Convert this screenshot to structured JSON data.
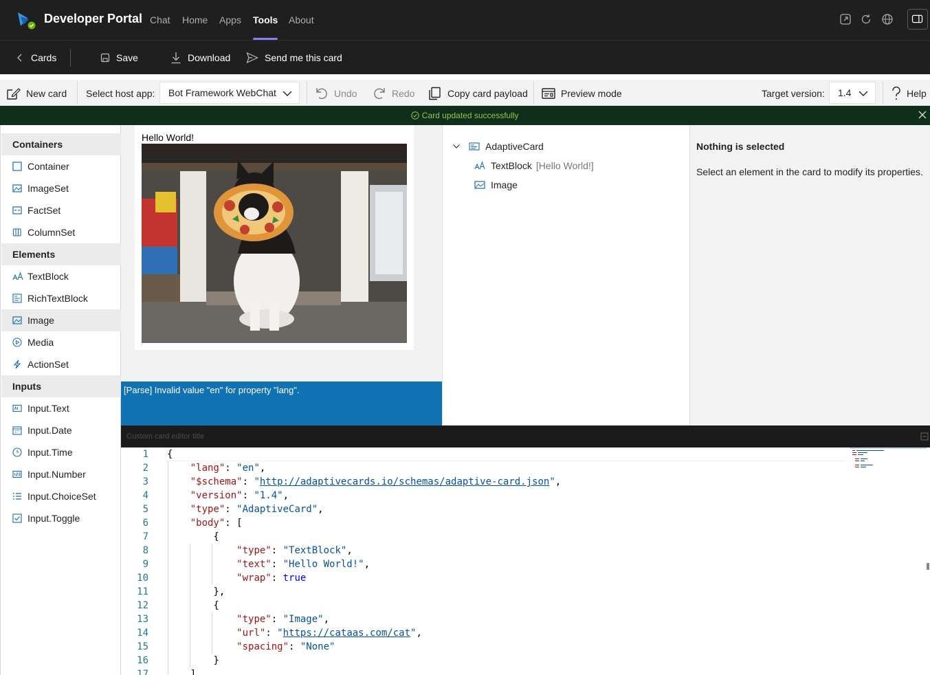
{
  "app": {
    "title": "Developer Portal",
    "nav_tabs": [
      "Chat",
      "Home",
      "Apps",
      "Tools",
      "About"
    ],
    "active_tab": "Tools",
    "accent_color": "#7f85f5"
  },
  "commands": {
    "back_label": "Cards",
    "save_label": "Save",
    "download_label": "Download",
    "send_label": "Send me this card"
  },
  "toolbar": {
    "new_card": "New card",
    "host_app_label": "Select host app:",
    "host_app_value": "Bot Framework WebChat",
    "undo": "Undo",
    "redo": "Redo",
    "copy_payload": "Copy card payload",
    "preview_mode": "Preview mode",
    "target_version_label": "Target version:",
    "target_version_value": "1.4",
    "help": "Help"
  },
  "toast": {
    "message": "Card updated successfully",
    "color": "#92c353"
  },
  "palette": {
    "groups": [
      {
        "header": "Containers",
        "items": [
          "Container",
          "ImageSet",
          "FactSet",
          "ColumnSet"
        ]
      },
      {
        "header": "Elements",
        "items": [
          "TextBlock",
          "RichTextBlock",
          "Image",
          "Media",
          "ActionSet"
        ]
      },
      {
        "header": "Inputs",
        "items": [
          "Input.Text",
          "Input.Date",
          "Input.Time",
          "Input.Number",
          "Input.ChoiceSet",
          "Input.Toggle"
        ]
      }
    ],
    "selected_item": "Image"
  },
  "card": {
    "text": "Hello World!",
    "image_alt": "cat-photo"
  },
  "error_message": "[Parse] Invalid value \"en\" for property \"lang\".",
  "tree": {
    "root": "AdaptiveCard",
    "children": [
      {
        "label": "TextBlock",
        "hint": "[Hello World!]"
      },
      {
        "label": "Image",
        "hint": ""
      }
    ]
  },
  "properties": {
    "title": "Nothing is selected",
    "body": "Select an element in the card to modify its properties."
  },
  "editor": {
    "title": "Custom card editor title",
    "line_numbers": [
      "1",
      "2",
      "3",
      "4",
      "5",
      "6",
      "7",
      "8",
      "9",
      "10",
      "11",
      "12",
      "13",
      "14",
      "15",
      "16",
      "17"
    ],
    "lines": [
      "{",
      "    \"lang\": \"en\",",
      "    \"$schema\": \"http://adaptivecards.io/schemas/adaptive-card.json\",",
      "    \"version\": \"1.4\",",
      "    \"type\": \"AdaptiveCard\",",
      "    \"body\": [",
      "        {",
      "            \"type\": \"TextBlock\",",
      "            \"text\": \"Hello World!\",",
      "            \"wrap\": true",
      "        },",
      "        {",
      "            \"type\": \"Image\",",
      "            \"url\": \"https://cataas.com/cat\",",
      "            \"spacing\": \"None\"",
      "        }",
      "    ]"
    ]
  }
}
